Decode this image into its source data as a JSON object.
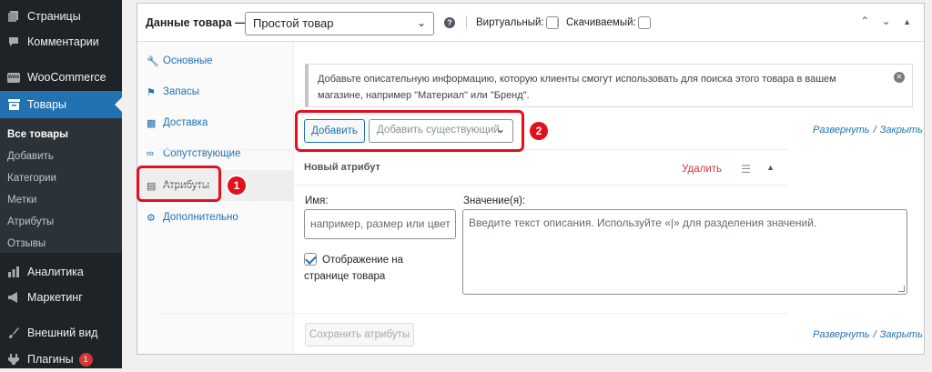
{
  "sidebar": {
    "items": [
      {
        "label": "Страницы",
        "icon": "pages-icon"
      },
      {
        "label": "Комментарии",
        "icon": "comments-icon"
      },
      {
        "label": "WooCommerce",
        "icon": "woocommerce-icon",
        "icon_text": "woo"
      },
      {
        "label": "Товары",
        "icon": "archive-icon"
      },
      {
        "label": "Аналитика",
        "icon": "analytics-icon"
      },
      {
        "label": "Маркетинг",
        "icon": "megaphone-icon"
      },
      {
        "label": "Внешний вид",
        "icon": "brush-icon"
      },
      {
        "label": "Плагины",
        "icon": "plugin-icon",
        "badge": "1"
      }
    ],
    "submenu": [
      "Все товары",
      "Добавить",
      "Категории",
      "Метки",
      "Атрибуты",
      "Отзывы"
    ]
  },
  "header": {
    "title": "Данные товара —",
    "product_type": "Простой товар",
    "help": "?",
    "virtual_label": "Виртуальный:",
    "downloadable_label": "Скачиваемый:"
  },
  "tabs": [
    {
      "label": "Основные",
      "icon": "wrench-icon"
    },
    {
      "label": "Запасы",
      "icon": "tag-icon"
    },
    {
      "label": "Доставка",
      "icon": "truck-icon"
    },
    {
      "label": "Сопутствующие",
      "icon": "link-icon"
    },
    {
      "label": "Атрибуты",
      "icon": "list-icon"
    },
    {
      "label": "Дополнительно",
      "icon": "gear-icon"
    }
  ],
  "notice": {
    "text": "Добавьте описательную информацию, которую клиенты смогут использовать для поиска этого товара в вашем магазине, например \"Материал\" или \"Бренд\"."
  },
  "toolbar": {
    "add_label": "Добавить",
    "existing_placeholder": "Добавить существующий",
    "expand": "Развернуть",
    "collapse": "Закрыть"
  },
  "attribute": {
    "title": "Новый атрибут",
    "remove": "Удалить",
    "name_label": "Имя:",
    "name_placeholder": "например, размер или цвет",
    "values_label": "Значение(я):",
    "values_placeholder": "Введите текст описания. Используйте «|» для разделения значений.",
    "visible_label": "Отображение на странице товара",
    "visible_checked": true
  },
  "footer": {
    "save_label": "Сохранить атрибуты",
    "expand": "Развернуть",
    "collapse": "Закрыть"
  },
  "markers": [
    "1",
    "2"
  ],
  "colors": {
    "accent": "#2271b1",
    "sidebar": "#1d2327",
    "highlight": "#e3101c",
    "danger": "#d63638"
  }
}
